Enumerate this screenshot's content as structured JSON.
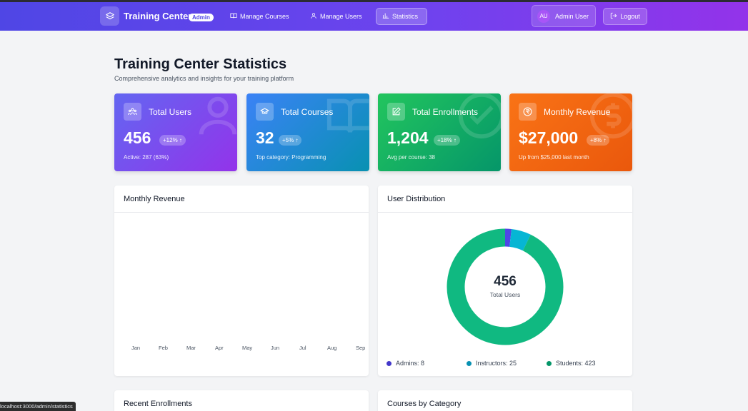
{
  "app": {
    "brand": "Training Center",
    "badge": "Admin"
  },
  "nav": {
    "items": [
      {
        "label": "Manage Courses",
        "icon": "book-icon"
      },
      {
        "label": "Manage Users",
        "icon": "users-icon"
      },
      {
        "label": "Statistics",
        "icon": "bar-chart-icon",
        "active": true
      }
    ],
    "user": {
      "initials": "AU",
      "name": "Admin User"
    },
    "logout_label": "Logout"
  },
  "page": {
    "title": "Training Center Statistics",
    "subtitle": "Comprehensive analytics and insights for your training platform"
  },
  "stats": [
    {
      "label": "Total Users",
      "value": "456",
      "change": "+12% ↑",
      "sub": "Active: 287 (63%)",
      "icon": "users-group-icon",
      "color_from": "#6366f1",
      "color_to": "#9333ea"
    },
    {
      "label": "Total Courses",
      "value": "32",
      "change": "+5% ↑",
      "sub": "Top category: Programming",
      "icon": "graduation-cap-icon",
      "color_from": "#3b82f6",
      "color_to": "#0891b2"
    },
    {
      "label": "Total Enrollments",
      "value": "1,204",
      "change": "+18% ↑",
      "sub": "Avg per course: 38",
      "icon": "edit-icon",
      "color_from": "#22c55e",
      "color_to": "#059669"
    },
    {
      "label": "Monthly Revenue",
      "value": "$27,000",
      "change": "+8% ↑",
      "sub": "Up from $25,000 last month",
      "icon": "rupee-icon",
      "color_from": "#f97316",
      "color_to": "#ea580c"
    }
  ],
  "panels": {
    "revenue": {
      "title": "Monthly Revenue",
      "months": [
        "Jan",
        "Feb",
        "Mar",
        "Apr",
        "May",
        "Jun",
        "Jul",
        "Aug",
        "Sep"
      ]
    },
    "distribution": {
      "title": "User Distribution",
      "center_value": "456",
      "center_label": "Total Users",
      "legend": [
        {
          "label": "Admins: 8",
          "color": "#4338ca"
        },
        {
          "label": "Instructors: 25",
          "color": "#0891b2"
        },
        {
          "label": "Students: 423",
          "color": "#059669"
        }
      ]
    },
    "recent_enrollments": {
      "title": "Recent Enrollments"
    },
    "courses_by_category": {
      "title": "Courses by Category"
    }
  },
  "chart_data": {
    "type": "pie",
    "categories": [
      "Admins",
      "Instructors",
      "Students"
    ],
    "values": [
      8,
      25,
      423
    ],
    "colors": [
      "#4f46e5",
      "#06b6d4",
      "#10b981"
    ],
    "title": "User Distribution"
  },
  "status_bar": {
    "url": "localhost:3000/admin/statistics"
  }
}
